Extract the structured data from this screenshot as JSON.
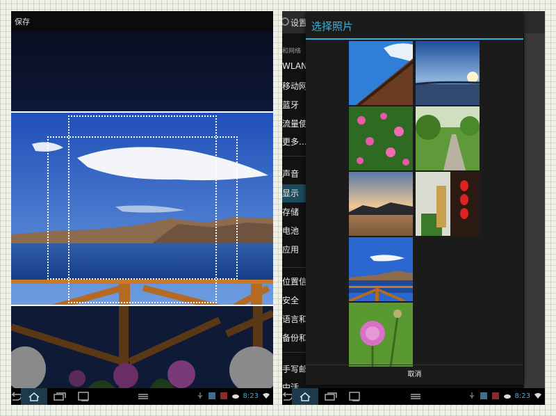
{
  "left_screen": {
    "save_label": "保存"
  },
  "right_screen": {
    "settings": {
      "title": "设置",
      "items": [
        {
          "label": "和网络",
          "kind": "category"
        },
        {
          "label": "WLAN",
          "kind": "item"
        },
        {
          "label": "移动网",
          "kind": "item"
        },
        {
          "label": "蓝牙",
          "kind": "item"
        },
        {
          "label": "流量使",
          "kind": "item"
        },
        {
          "label": "更多...",
          "kind": "item"
        },
        {
          "label": "声音",
          "kind": "item"
        },
        {
          "label": "显示",
          "kind": "item",
          "selected": true
        },
        {
          "label": "存储",
          "kind": "item"
        },
        {
          "label": "电池",
          "kind": "item"
        },
        {
          "label": "应用",
          "kind": "item"
        },
        {
          "label": "位置信",
          "kind": "item"
        },
        {
          "label": "安全",
          "kind": "item"
        },
        {
          "label": "语言和",
          "kind": "item"
        },
        {
          "label": "备份和",
          "kind": "item"
        },
        {
          "label": "手写邮",
          "kind": "item"
        },
        {
          "label": "中活",
          "kind": "item"
        }
      ]
    },
    "dialog": {
      "title": "选择照片",
      "cancel_label": "取消",
      "thumbnails": [
        "roof-eaves-sky",
        "sunset-over-water",
        "pink-flowers",
        "garden-path",
        "lake-dusk",
        "red-lanterns",
        "lake-railing",
        "pink-pompom-flower"
      ]
    }
  },
  "status_bar": {
    "time_left": "8:23",
    "time_right": "8:23"
  },
  "colors": {
    "accent": "#33b5e5",
    "panel_bg": "#1b1b1b",
    "selected_item": "#1a4a5c"
  },
  "icons": [
    "back-icon",
    "home-icon",
    "recents-icon",
    "screenshot-icon",
    "menu-icon",
    "usb-icon",
    "weather-icon",
    "wifi-icon",
    "gear-icon"
  ]
}
